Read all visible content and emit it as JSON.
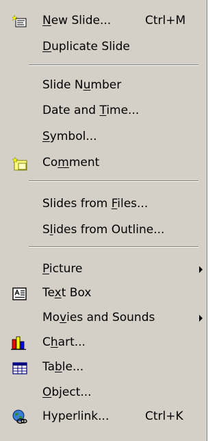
{
  "menu": {
    "items": [
      {
        "label": "New Slide...",
        "accel": "N",
        "shortcut": "Ctrl+M",
        "icon": "new-slide-icon"
      },
      {
        "label": "Duplicate Slide",
        "accel": "D"
      },
      {
        "label": "Slide Number",
        "accel": "u"
      },
      {
        "label": "Date and Time...",
        "accel": "T"
      },
      {
        "label": "Symbol...",
        "accel": "S"
      },
      {
        "label": "Comment",
        "accel": "m",
        "icon": "comment-icon"
      },
      {
        "label": "Slides from Files...",
        "accel": "F"
      },
      {
        "label": "Slides from Outline...",
        "accel": "l"
      },
      {
        "label": "Picture",
        "accel": "P",
        "submenu": true
      },
      {
        "label": "Text Box",
        "accel": "x",
        "icon": "text-box-icon"
      },
      {
        "label": "Movies and Sounds",
        "accel": "v",
        "submenu": true
      },
      {
        "label": "Chart...",
        "accel": "h",
        "icon": "chart-icon"
      },
      {
        "label": "Table...",
        "accel": "b",
        "icon": "table-icon"
      },
      {
        "label": "Object...",
        "accel": "O"
      },
      {
        "label": "Hyperlink...",
        "accel": "I",
        "shortcut": "Ctrl+K",
        "icon": "hyperlink-icon"
      }
    ]
  }
}
